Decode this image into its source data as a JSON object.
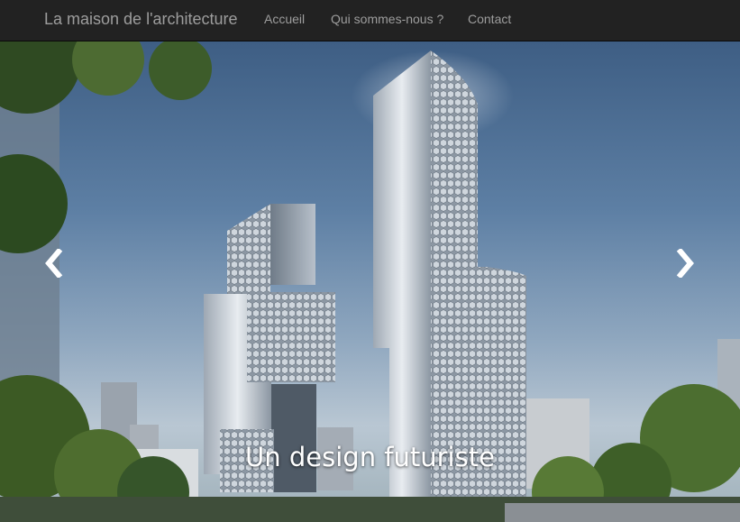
{
  "navbar": {
    "brand": "La maison de l'architecture",
    "links": [
      "Accueil",
      "Qui sommes-nous ?",
      "Contact"
    ]
  },
  "carousel": {
    "caption": "Un design futuriste",
    "slide_count": 3,
    "active_slide": 2,
    "prev_icon": "chevron-left-icon",
    "next_icon": "chevron-right-icon"
  },
  "colors": {
    "navbar_bg": "#222222",
    "nav_text": "#9d9d9d",
    "caption_text": "#ffffff"
  }
}
